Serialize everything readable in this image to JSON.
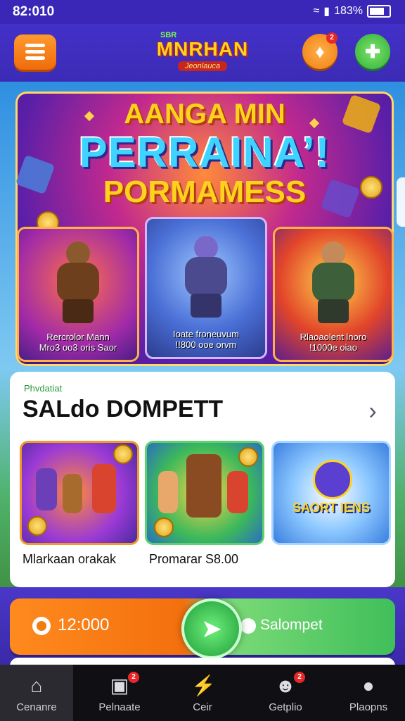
{
  "status": {
    "time": "82:010",
    "battery": "183%"
  },
  "header": {
    "logo_small": "SBR",
    "logo_main": "MNRHAN",
    "logo_ribbon": "Jeonlauca",
    "notif_count": "2"
  },
  "hero": {
    "title_line1": "AANGA MIN",
    "title_line2": "PERRAINA’!",
    "title_line3": "PORMAMESS",
    "cards": [
      {
        "caption_line1": "Rercrolor Mann",
        "caption_line2": "Mro3 oo3 oris Saor"
      },
      {
        "caption_line1": "Ioate froneuvum",
        "caption_line2": "!!800 ooe orvm"
      },
      {
        "caption_line1": "Rlaoaolent lnoro",
        "caption_line2": "!1000e oiao"
      }
    ]
  },
  "wallet": {
    "eyebrow": "Phvdatiat",
    "title": "SALdo DOMPETT",
    "tiles": [
      {
        "label": "Mlarkaan orakak"
      },
      {
        "label": "Promarar S8.00"
      },
      {
        "emblem_text": "SAORT IENS"
      }
    ]
  },
  "cta": {
    "amount": "12:000",
    "send_label": "Salompet"
  },
  "tabbar": {
    "items": [
      {
        "label": "Cenanre",
        "icon": "home-icon",
        "active": true
      },
      {
        "label": "Pelnaate",
        "icon": "inbox-icon",
        "badge": "2"
      },
      {
        "label": "Ceir",
        "icon": "bolt-icon"
      },
      {
        "label": "Getplio",
        "icon": "game-icon",
        "badge": "2"
      },
      {
        "label": "Plaopns",
        "icon": "person-icon"
      }
    ]
  },
  "colors": {
    "primary": "#3c2bb5",
    "accent_orange": "#f07d10",
    "accent_green": "#2fb03a",
    "title_yellow": "#ffd21c"
  }
}
